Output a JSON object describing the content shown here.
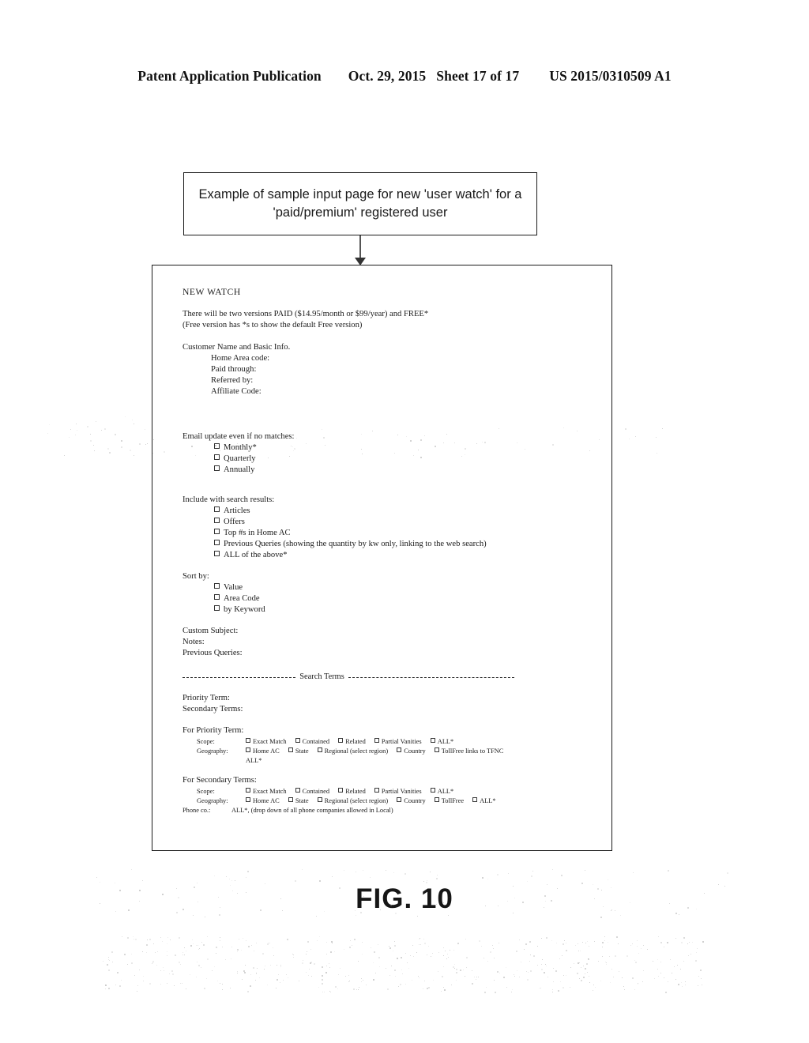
{
  "header": {
    "publication": "Patent Application Publication",
    "date": "Oct. 29, 2015",
    "sheet": "Sheet 17 of 17",
    "number": "US 2015/0310509 A1"
  },
  "callout": {
    "line1": "Example of sample input page for new 'user watch' for a",
    "line2": "'paid/premium' registered user"
  },
  "form": {
    "title": "NEW WATCH",
    "intro_line1": "There will be two versions PAID ($14.95/month or $99/year) and FREE*",
    "intro_line2": "(Free version has *s to show the default Free version)",
    "customer_section": {
      "heading": "Customer Name and Basic Info.",
      "fields": [
        "Home Area code:",
        "Paid through:",
        "Referred by:",
        "Affiliate Code:"
      ]
    },
    "email_section": {
      "heading": "Email update even if no matches:",
      "options": [
        "Monthly*",
        "Quarterly",
        "Annually"
      ]
    },
    "include_section": {
      "heading": "Include with search results:",
      "options": [
        "Articles",
        "Offers",
        "Top #s in Home AC",
        "Previous Queries (showing the quantity by kw only, linking to the web search)",
        "ALL of the above*"
      ]
    },
    "sort_section": {
      "heading": "Sort by:",
      "options": [
        "Value",
        "Area Code",
        "by Keyword"
      ]
    },
    "misc_fields": [
      "Custom Subject:",
      "Notes:",
      "Previous Queries:"
    ],
    "divider_label": "Search Terms",
    "term_fields": [
      "Priority Term:",
      "Secondary Terms:"
    ],
    "priority_block": {
      "title": "For Priority Term:",
      "scope_label": "Scope:",
      "scope_options": [
        "Exact Match",
        "Contained",
        "Related",
        "Partial Vanities",
        "ALL*"
      ],
      "geography_label": "Geography:",
      "geography_options": [
        "Home AC",
        "State",
        "Regional (select region)",
        "Country",
        "TollFree links to TFNC"
      ],
      "geography_continued": "ALL*"
    },
    "secondary_block": {
      "title": "For Secondary Terms:",
      "scope_label": "Scope:",
      "scope_options": [
        "Exact Match",
        "Contained",
        "Related",
        "Partial Vanities",
        "ALL*"
      ],
      "geography_label": "Geography:",
      "geography_options": [
        "Home AC",
        "State",
        "Regional (select region)",
        "Country",
        "TollFree",
        "ALL*"
      ],
      "phone_label": "Phone co.:",
      "phone_value": "ALL*, (drop down of all phone companies allowed in Local)"
    }
  },
  "figure_caption": "FIG. 10"
}
